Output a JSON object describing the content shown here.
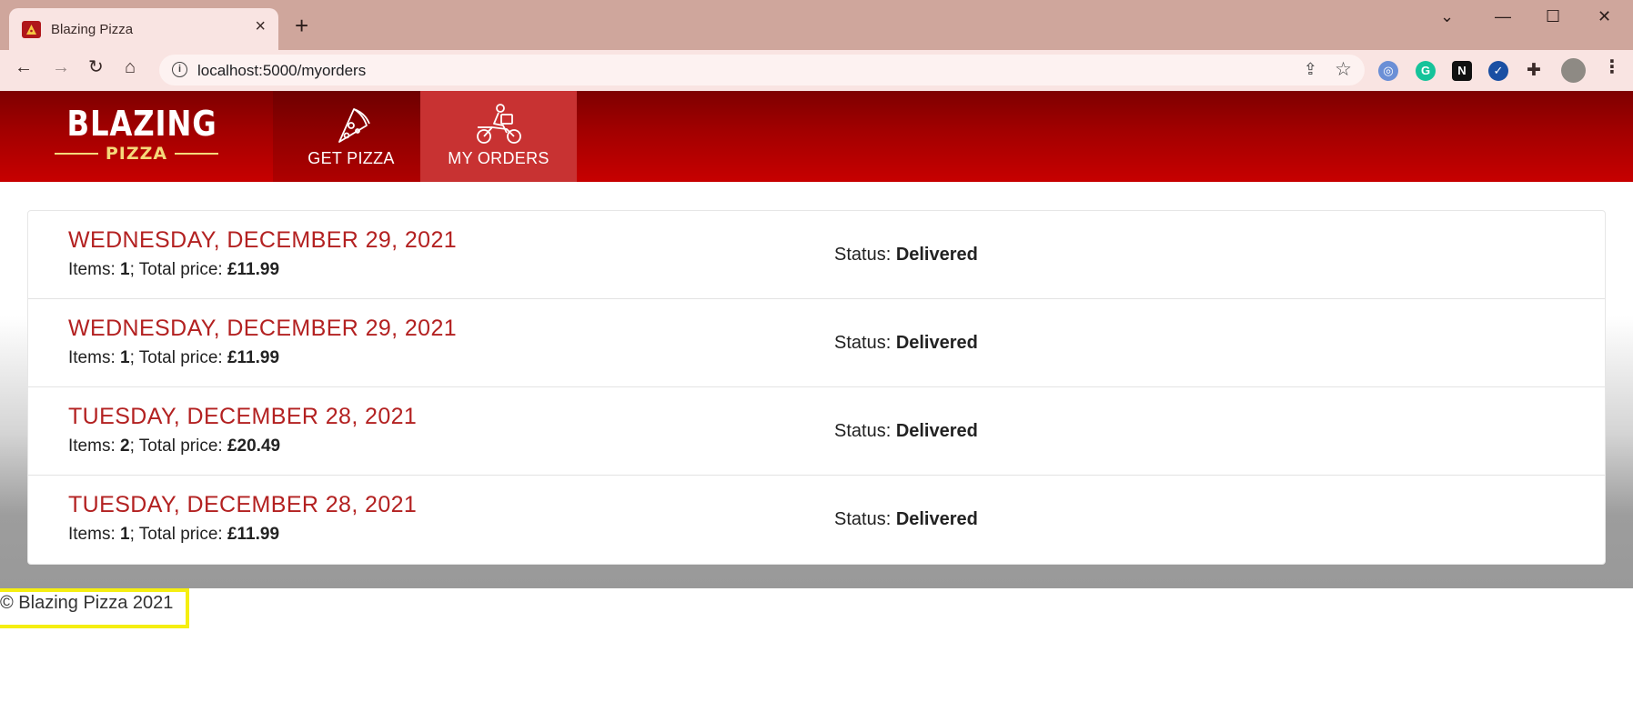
{
  "browser": {
    "tab_title": "Blazing Pizza",
    "url": "localhost:5000/myorders"
  },
  "header": {
    "logo_main": "BLAZING",
    "logo_sub": "PIZZA",
    "nav": [
      {
        "label": "GET PIZZA",
        "icon": "pizza-slice-icon",
        "active": false
      },
      {
        "label": "MY ORDERS",
        "icon": "delivery-bike-icon",
        "active": true
      }
    ]
  },
  "colors": {
    "brand_red": "#c70000",
    "date_red": "#b32121",
    "footer_highlight": "#f5ee11"
  },
  "orders": [
    {
      "date": "WEDNESDAY, DECEMBER 29, 2021",
      "items_label": "Items: ",
      "items": "1",
      "price_label": "; Total price: ",
      "price": "£11.99",
      "status_label": "Status: ",
      "status": "Delivered"
    },
    {
      "date": "WEDNESDAY, DECEMBER 29, 2021",
      "items_label": "Items: ",
      "items": "1",
      "price_label": "; Total price: ",
      "price": "£11.99",
      "status_label": "Status: ",
      "status": "Delivered"
    },
    {
      "date": "TUESDAY, DECEMBER 28, 2021",
      "items_label": "Items: ",
      "items": "2",
      "price_label": "; Total price: ",
      "price": "£20.49",
      "status_label": "Status: ",
      "status": "Delivered"
    },
    {
      "date": "TUESDAY, DECEMBER 28, 2021",
      "items_label": "Items: ",
      "items": "1",
      "price_label": "; Total price: ",
      "price": "£11.99",
      "status_label": "Status: ",
      "status": "Delivered"
    }
  ],
  "footer": {
    "text": "© Blazing Pizza 2021"
  }
}
